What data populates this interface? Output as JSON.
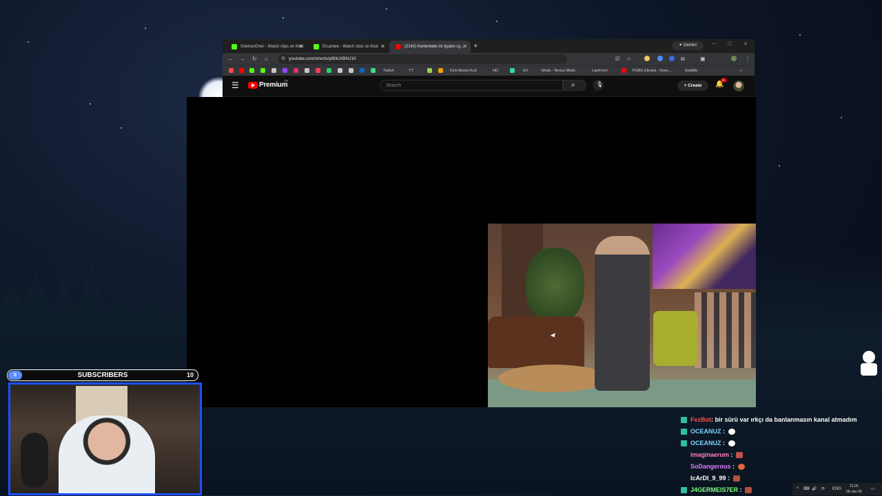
{
  "browser": {
    "tabs": [
      {
        "title": "GokhanOner - Watch clips on Kick",
        "favicon_color": "#53fc18",
        "active": false
      },
      {
        "title": "Ercantee - Watch clips on Kick",
        "favicon_color": "#53fc18",
        "active": false
      },
      {
        "title": "(2142) Kertenkele mi tiyatro cy...",
        "favicon_color": "#ff0000",
        "active": true
      }
    ],
    "new_tab": "+",
    "gemini_label": "Gemini",
    "url": "youtube.com/shorts/yl83cXBNJ10",
    "bookmarks": [
      {
        "label": "Twitch",
        "color": "#9146ff"
      },
      {
        "label": "YT",
        "color": "#c7c7c7"
      },
      {
        "label": "Kick Abone Kod",
        "color": "#53fc18"
      },
      {
        "label": "HD",
        "color": "#c7c7c7"
      },
      {
        "label": "EV",
        "color": "#c7c7c7"
      },
      {
        "label": "Mods - Nexus Mods",
        "color": "#f4a300"
      },
      {
        "label": "LawForm",
        "color": "#c7c7c7"
      },
      {
        "label": "PUBG Elestra - Sees...",
        "color": "#4a6a8a"
      },
      {
        "label": "Subtitle",
        "color": "#c7c7c7"
      }
    ]
  },
  "youtube": {
    "brand": "Premium",
    "region": "TR",
    "search_placeholder": "Search",
    "create_label": "Create",
    "notifications_badge": "9+"
  },
  "overlay": {
    "subscribers_label": "SUBSCRIBERS",
    "subscribers_min": "0",
    "subscribers_max": "10"
  },
  "chat": [
    {
      "user": "FezBot",
      "user_color": "#ff4a4a",
      "text": ": bir sürü var ırkçı da banlanmasın kanal atmadım",
      "emote": ""
    },
    {
      "user": "OCEANUZ",
      "user_color": "#7fd7ff",
      "text": ":",
      "emote": "#ffffff"
    },
    {
      "user": "OCEANUZ",
      "user_color": "#7fd7ff",
      "text": ":",
      "emote": "#ffffff"
    },
    {
      "user": "imaginaerum",
      "user_color": "#ff7fbf",
      "text": ":",
      "emote": "#c0504d"
    },
    {
      "user": "SoDangerous",
      "user_color": "#d67fff",
      "text": ":",
      "emote": "#e0653a"
    },
    {
      "user": "IcArDI_9_99",
      "user_color": "#ffffff",
      "text": ":",
      "emote": "#b05040"
    },
    {
      "user": "J4GERMEIS7ER",
      "user_color": "#7fff7f",
      "text": ":",
      "emote": "#b05040"
    }
  ],
  "taskbar": {
    "language": "ENG",
    "time": "21:26",
    "date": "05-Jan-26"
  }
}
